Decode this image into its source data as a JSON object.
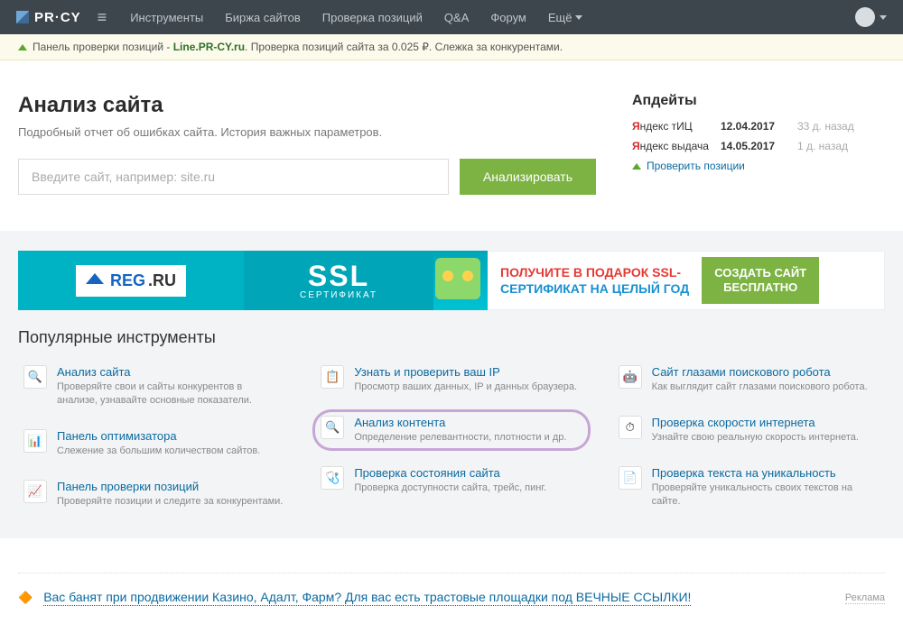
{
  "brand": "PR·CY",
  "nav": [
    "Инструменты",
    "Биржа сайтов",
    "Проверка позиций",
    "Q&A",
    "Форум"
  ],
  "nav_more": "Ещё",
  "alert": {
    "t1": "Панель проверки позиций - ",
    "link": "Line.PR-CY.ru",
    "t2": ". Проверка позиций сайта за 0.025 ₽. Слежка за конкурентами."
  },
  "hero": {
    "title": "Анализ сайта",
    "sub": "Подробный отчет об ошибках сайта. История важных параметров.",
    "placeholder": "Введите сайт, например: site.ru",
    "btn": "Анализировать"
  },
  "updates": {
    "title": "Апдейты",
    "rows": [
      {
        "src_pre": "Я",
        "src": "ндекс тИЦ",
        "date": "12.04.2017",
        "ago": "33 д. назад"
      },
      {
        "src_pre": "Я",
        "src": "ндекс выдача",
        "date": "14.05.2017",
        "ago": "1 д. назад"
      }
    ],
    "check": "Проверить позиции"
  },
  "banner": {
    "reg1": "REG",
    "reg2": ".RU",
    "ssl": "SSL",
    "ssl_sub": "СЕРТИФИКАТ",
    "l1": "ПОЛУЧИТЕ В ПОДАРОК SSL-",
    "l2": "СЕРТИФИКАТ НА ЦЕЛЫЙ ГОД",
    "btn1": "СОЗДАТЬ САЙТ",
    "btn2": "БЕСПЛАТНО"
  },
  "pop_title": "Популярные инструменты",
  "tools": {
    "col1": [
      {
        "t": "Анализ сайта",
        "d": "Проверяйте свои и сайты конкурентов в анализе, узнавайте основные показатели.",
        "icon": "🔍"
      },
      {
        "t": "Панель оптимизатора",
        "d": "Слежение за большим количеством сайтов.",
        "icon": "📊"
      },
      {
        "t": "Панель проверки позиций",
        "d": "Проверяйте позиции и следите за конкурентами.",
        "icon": "📈"
      }
    ],
    "col2": [
      {
        "t": "Узнать и проверить ваш IP",
        "d": "Просмотр ваших данных, IP и данных браузера.",
        "icon": "📋"
      },
      {
        "t": "Анализ контента",
        "d": "Определение релевантности, плотности и др.",
        "icon": "🔍",
        "hl": true
      },
      {
        "t": "Проверка состояния сайта",
        "d": "Проверка доступности сайта, трейс, пинг.",
        "icon": "🩺"
      }
    ],
    "col3": [
      {
        "t": "Сайт глазами поискового робота",
        "d": "Как выглядит сайт глазами поискового робота.",
        "icon": "🤖"
      },
      {
        "t": "Проверка скорости интернета",
        "d": "Узнайте свою реальную скорость интернета.",
        "icon": "⏱"
      },
      {
        "t": "Проверка текста на уникальность",
        "d": "Проверяйте уникальность своих текстов на сайте.",
        "icon": "📄"
      }
    ]
  },
  "promo": {
    "text": "Вас банят при продвижении Казино, Адалт, Фарм? Для вас есть трастовые площадки под ВЕЧНЫЕ ССЫЛКИ!",
    "ad": "Реклама"
  }
}
